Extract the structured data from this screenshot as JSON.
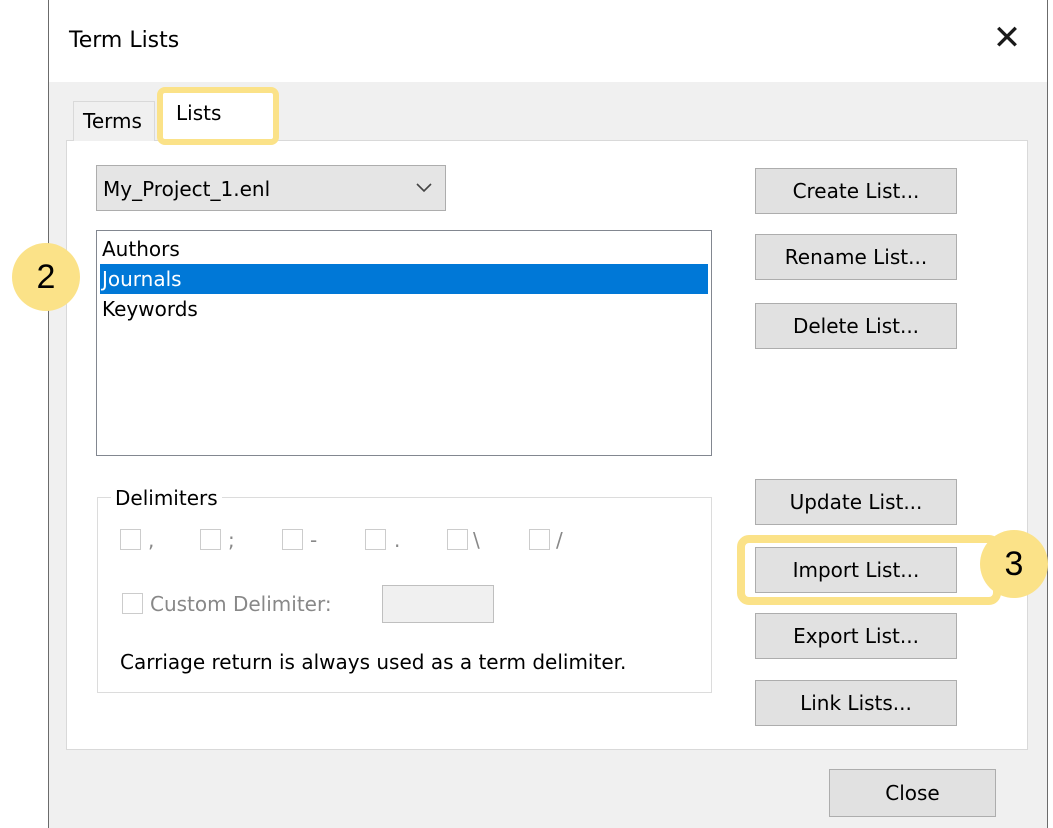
{
  "dialog": {
    "title": "Term Lists",
    "close_glyph": "✕"
  },
  "tabs": [
    {
      "label": "Terms",
      "active": false
    },
    {
      "label": "Lists",
      "active": true
    }
  ],
  "combo": {
    "value": "My_Project_1.enl"
  },
  "list": {
    "items": [
      {
        "label": "Authors",
        "selected": false
      },
      {
        "label": "Journals",
        "selected": true
      },
      {
        "label": "Keywords",
        "selected": false
      }
    ]
  },
  "delimiters": {
    "group_label": "Delimiters",
    "options": [
      ",",
      ";",
      "-",
      ".",
      "\\",
      "/"
    ],
    "custom_label": "Custom Delimiter:",
    "custom_value": "",
    "note": "Carriage return is always used as a term delimiter."
  },
  "buttons": {
    "create": "Create List...",
    "rename": "Rename List...",
    "delete": "Delete List...",
    "update": "Update List...",
    "import": "Import List...",
    "export": "Export List...",
    "link": "Link Lists...",
    "close": "Close"
  },
  "callouts": {
    "step_2": "2",
    "step_3": "3",
    "highlight_color": "#fbe288"
  },
  "colors": {
    "selection": "#0078d7",
    "dialog_bg": "#f0f0f0",
    "button_bg": "#e1e1e1"
  },
  "icons": {
    "combo": "chevron-down-icon",
    "close": "close-icon"
  }
}
